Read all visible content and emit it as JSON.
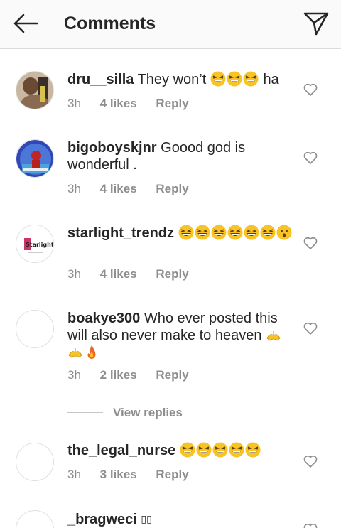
{
  "header": {
    "title": "Comments",
    "back_icon": "arrow-left-icon",
    "send_icon": "paper-plane-icon"
  },
  "comments": [
    {
      "username": "dru__silla",
      "text_before": "They won’t",
      "emojis": [
        "grinning-squinting-face",
        "grinning-squinting-face",
        "grinning-squinting-face"
      ],
      "text_after": "ha",
      "time": "3h",
      "likes": "4 likes",
      "reply": "Reply"
    },
    {
      "username": "bigoboyskjnr",
      "text_before": "Goood god is wonderful .",
      "time": "3h",
      "likes": "4 likes",
      "reply": "Reply"
    },
    {
      "username": "starlight_trendz",
      "emojis": [
        "grinning-squinting-face",
        "grinning-squinting-face",
        "grinning-squinting-face",
        "grinning-squinting-face",
        "grinning-squinting-face",
        "grinning-squinting-face",
        "hushed-face"
      ],
      "avatar_text": "Starlight",
      "time": "3h",
      "likes": "4 likes",
      "reply": "Reply"
    },
    {
      "username": "boakye300",
      "text_before": "Who ever posted this will also never make to heaven",
      "emojis": [
        "folded-hands",
        "folded-hands",
        "fire"
      ],
      "time": "3h",
      "likes": "2 likes",
      "reply": "Reply"
    },
    {
      "username": "the_legal_nurse",
      "emojis": [
        "grinning-squinting-face",
        "grinning-squinting-face",
        "grinning-squinting-face",
        "grinning-squinting-face",
        "grinning-squinting-face"
      ],
      "time": "3h",
      "likes": "3 likes",
      "reply": "Reply"
    },
    {
      "username": "_bragweci",
      "text_before": "\u0000\u0000"
    }
  ],
  "view_replies": "View replies",
  "colors": {
    "text": "#262626",
    "muted": "#8e8e8e",
    "emoji_yellow": "#f7c325",
    "divider": "#dbdbdb"
  }
}
